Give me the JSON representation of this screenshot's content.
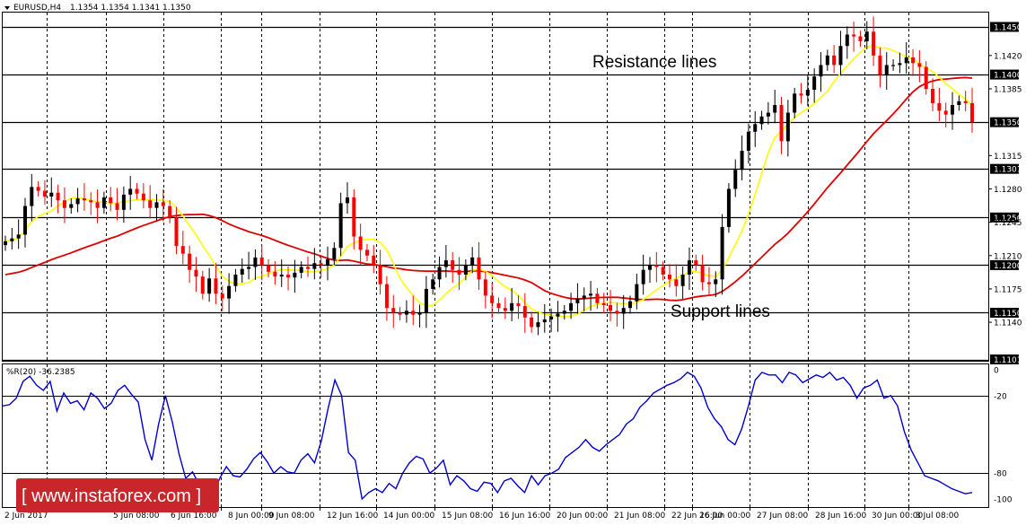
{
  "header": {
    "symbol_tf": "EURUSD,H4",
    "ohlc": "1.1354 1.1354 1.1341 1.1350"
  },
  "indicator_label": "%R(20) -36.2385",
  "annotations": {
    "resistance": "Resistance lines",
    "support": "Support lines"
  },
  "watermark": "[ www.instaforex.com ]",
  "colors": {
    "bull": "#000000",
    "bear": "#ff0000",
    "fast_ma": "#ffff00",
    "slow_ma": "#dd0000",
    "wpr": "#0000cc",
    "watermark_bg": "#c9262c"
  },
  "chart_data": [
    {
      "type": "candlestick",
      "title": "EURUSD,H4",
      "ylim": [
        1.1101,
        1.1458
      ],
      "y_ticks": [
        "1.1450",
        "1.1420",
        "1.1400",
        "1.1385",
        "1.1350",
        "1.1315",
        "1.1301",
        "1.1280",
        "1.1250",
        "1.1245",
        "1.1210",
        "1.1200",
        "1.1175",
        "1.1150",
        "1.1140",
        "1.1101"
      ],
      "price_box_ticks": [
        "1.1450",
        "1.1400",
        "1.1350",
        "1.1301",
        "1.1250",
        "1.1200",
        "1.1150",
        "1.1101"
      ],
      "horizontal_levels": [
        1.145,
        1.14,
        1.135,
        1.1301,
        1.125,
        1.12,
        1.115,
        1.1101
      ],
      "x_tick_labels": [
        "2 Jun 2017",
        "5 Jun 08:00",
        "6 Jun 16:00",
        "8 Jun 00:00",
        "9 Jun 08:00",
        "12 Jun 16:00",
        "14 Jun 00:00",
        "15 Jun 08:00",
        "16 Jun 16:00",
        "20 Jun 00:00",
        "21 Jun 08:00",
        "22 Jun 16:00",
        "26 Jun 00:00",
        "27 Jun 08:00",
        "28 Jun 16:00",
        "30 Jun 00:00",
        "3 Jul 08:00"
      ],
      "closes": [
        1.1225,
        1.1228,
        1.1232,
        1.1262,
        1.1282,
        1.1278,
        1.1272,
        1.1276,
        1.1268,
        1.126,
        1.1264,
        1.127,
        1.1268,
        1.1266,
        1.126,
        1.1271,
        1.1265,
        1.1258,
        1.1274,
        1.128,
        1.1275,
        1.1268,
        1.126,
        1.1266,
        1.1262,
        1.125,
        1.122,
        1.1212,
        1.1195,
        1.1188,
        1.117,
        1.1186,
        1.117,
        1.1165,
        1.1178,
        1.119,
        1.1196,
        1.1198,
        1.1208,
        1.12,
        1.1193,
        1.1188,
        1.119,
        1.1187,
        1.1192,
        1.1198,
        1.1196,
        1.1202,
        1.12,
        1.1206,
        1.1218,
        1.1265,
        1.1271,
        1.123,
        1.1216,
        1.121,
        1.12,
        1.118,
        1.1155,
        1.115,
        1.1148,
        1.1152,
        1.1148,
        1.115,
        1.1175,
        1.1185,
        1.1198,
        1.1205,
        1.1195,
        1.119,
        1.12,
        1.1208,
        1.1185,
        1.1168,
        1.116,
        1.1155,
        1.1152,
        1.116,
        1.1157,
        1.1145,
        1.1135,
        1.114,
        1.1143,
        1.1146,
        1.1149,
        1.1152,
        1.116,
        1.1165,
        1.1168,
        1.117,
        1.116,
        1.1158,
        1.1152,
        1.1149,
        1.1155,
        1.1162,
        1.118,
        1.1195,
        1.12,
        1.1198,
        1.119,
        1.1185,
        1.1178,
        1.119,
        1.1205,
        1.12,
        1.1182,
        1.118,
        1.1185,
        1.124,
        1.128,
        1.13,
        1.132,
        1.134,
        1.1348,
        1.1356,
        1.136,
        1.1368,
        1.133,
        1.136,
        1.138,
        1.1378,
        1.1384,
        1.1398,
        1.141,
        1.142,
        1.141,
        1.143,
        1.1442,
        1.144,
        1.1435,
        1.1445,
        1.142,
        1.14,
        1.141,
        1.141,
        1.1412,
        1.1418,
        1.1412,
        1.1408,
        1.1385,
        1.137,
        1.1362,
        1.1358,
        1.1368,
        1.1372,
        1.137,
        1.135
      ],
      "fast_ma_series_color": "yellow",
      "slow_ma_series_color": "red"
    },
    {
      "type": "line",
      "title": "%R(20) -36.2385",
      "ylim": [
        -100,
        0
      ],
      "y_ticks": [
        "0",
        "-20",
        "-80",
        "-100"
      ],
      "levels": [
        -20,
        -80
      ],
      "values": [
        -28,
        -27,
        -22,
        -9,
        -5,
        -12,
        -16,
        -9,
        -32,
        -18,
        -26,
        -24,
        -31,
        -18,
        -22,
        -30,
        -26,
        -16,
        -12,
        -19,
        -25,
        -54,
        -70,
        -42,
        -20,
        -40,
        -65,
        -84,
        -79,
        -89,
        -86,
        -98,
        -84,
        -75,
        -82,
        -83,
        -77,
        -69,
        -64,
        -71,
        -80,
        -75,
        -79,
        -80,
        -70,
        -65,
        -72,
        -55,
        -30,
        -8,
        -20,
        -64,
        -70,
        -100,
        -95,
        -92,
        -95,
        -88,
        -92,
        -80,
        -72,
        -67,
        -69,
        -80,
        -76,
        -70,
        -89,
        -82,
        -86,
        -92,
        -94,
        -87,
        -88,
        -95,
        -86,
        -84,
        -90,
        -95,
        -82,
        -89,
        -82,
        -80,
        -77,
        -68,
        -64,
        -60,
        -54,
        -60,
        -63,
        -58,
        -54,
        -50,
        -42,
        -38,
        -29,
        -24,
        -18,
        -15,
        -12,
        -10,
        -7,
        -2,
        -5,
        -14,
        -29,
        -38,
        -44,
        -54,
        -58,
        -46,
        -28,
        -8,
        -2,
        -4,
        -4,
        -10,
        -2,
        -4,
        -10,
        -7,
        -4,
        -6,
        -2,
        -8,
        -6,
        -12,
        -22,
        -14,
        -12,
        -8,
        -22,
        -20,
        -28,
        -48,
        -62,
        -72,
        -82,
        -84,
        -86,
        -89,
        -92,
        -94,
        -96,
        -95
      ]
    }
  ]
}
